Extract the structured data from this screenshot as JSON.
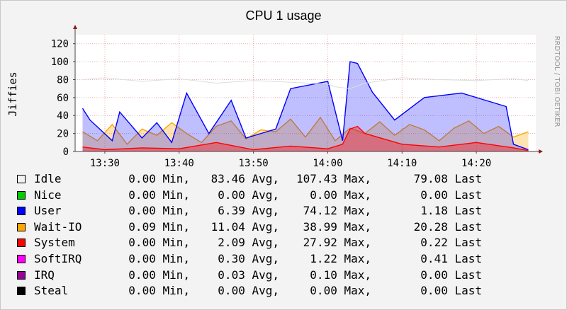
{
  "chart_data": {
    "type": "area",
    "title": "CPU 1 usage",
    "ylabel": "Jiffies",
    "watermark": "RRDTOOL / TOBI OETIKER",
    "ylim": [
      0,
      130
    ],
    "yticks": [
      0,
      20,
      40,
      60,
      80,
      100,
      120
    ],
    "xlim": [
      "13:26",
      "14:28"
    ],
    "xticks": [
      "13:30",
      "13:40",
      "13:50",
      "14:00",
      "14:10",
      "14:20"
    ],
    "grid": true,
    "series": [
      {
        "name": "Idle",
        "color": "#f2f2f2",
        "stats": {
          "min": "0.00",
          "avg": "83.46",
          "max": "107.43",
          "last": "79.08"
        },
        "x": [
          "13:27",
          "13:30",
          "13:35",
          "13:40",
          "13:45",
          "13:50",
          "13:55",
          "14:00",
          "14:01",
          "14:03",
          "14:05",
          "14:10",
          "14:15",
          "14:20",
          "14:25",
          "14:27"
        ],
        "values": [
          80,
          82,
          78,
          81,
          76,
          79,
          77,
          75,
          72,
          70,
          76,
          82,
          80,
          79,
          81,
          79
        ]
      },
      {
        "name": "Nice",
        "color": "#00cc00",
        "stats": {
          "min": "0.00",
          "avg": "0.00",
          "max": "0.00",
          "last": "0.00"
        },
        "values": []
      },
      {
        "name": "User",
        "color": "#0000ff",
        "stats": {
          "min": "0.00",
          "avg": "6.39",
          "max": "74.12",
          "last": "1.18"
        },
        "x": [
          "13:27",
          "13:28",
          "13:31",
          "13:32",
          "13:35",
          "13:37",
          "13:39",
          "13:41",
          "13:44",
          "13:47",
          "13:49",
          "13:53",
          "13:55",
          "14:00",
          "14:02",
          "14:03",
          "14:04",
          "14:06",
          "14:09",
          "14:13",
          "14:18",
          "14:24",
          "14:25",
          "14:27"
        ],
        "values": [
          48,
          35,
          12,
          44,
          15,
          32,
          10,
          65,
          20,
          57,
          15,
          25,
          70,
          78,
          12,
          100,
          98,
          66,
          35,
          60,
          65,
          50,
          8,
          2
        ]
      },
      {
        "name": "Wait-IO",
        "color": "#ffa500",
        "stats": {
          "min": "0.09",
          "avg": "11.04",
          "max": "38.99",
          "last": "20.28"
        },
        "x": [
          "13:27",
          "13:29",
          "13:31",
          "13:33",
          "13:35",
          "13:37",
          "13:39",
          "13:41",
          "13:43",
          "13:45",
          "13:47",
          "13:49",
          "13:51",
          "13:53",
          "13:55",
          "13:57",
          "13:59",
          "14:01",
          "14:03",
          "14:05",
          "14:07",
          "14:09",
          "14:11",
          "14:13",
          "14:15",
          "14:17",
          "14:19",
          "14:21",
          "14:23",
          "14:25",
          "14:27"
        ],
        "values": [
          22,
          12,
          30,
          8,
          25,
          18,
          32,
          20,
          10,
          28,
          34,
          14,
          24,
          22,
          36,
          16,
          38,
          12,
          26,
          20,
          33,
          18,
          30,
          24,
          12,
          26,
          34,
          20,
          28,
          16,
          22
        ]
      },
      {
        "name": "System",
        "color": "#ff0000",
        "stats": {
          "min": "0.00",
          "avg": "2.09",
          "max": "27.92",
          "last": "0.22"
        },
        "x": [
          "13:27",
          "13:30",
          "13:35",
          "13:40",
          "13:45",
          "13:50",
          "13:55",
          "14:00",
          "14:02",
          "14:03",
          "14:04",
          "14:05",
          "14:10",
          "14:15",
          "14:20",
          "14:25",
          "14:27"
        ],
        "values": [
          5,
          2,
          4,
          3,
          10,
          2,
          6,
          3,
          8,
          25,
          28,
          20,
          8,
          5,
          10,
          4,
          1
        ]
      },
      {
        "name": "SoftIRQ",
        "color": "#ff00ff",
        "stats": {
          "min": "0.00",
          "avg": "0.30",
          "max": "1.22",
          "last": "0.41"
        },
        "values": []
      },
      {
        "name": "IRQ",
        "color": "#990099",
        "stats": {
          "min": "0.00",
          "avg": "0.03",
          "max": "0.10",
          "last": "0.00"
        },
        "values": []
      },
      {
        "name": "Steal",
        "color": "#000000",
        "stats": {
          "min": "0.00",
          "avg": "0.00",
          "max": "0.00",
          "last": "0.00"
        },
        "values": []
      }
    ],
    "legend_units": {
      "min": "Min,",
      "avg": "Avg,",
      "max": "Max,",
      "last": "Last"
    }
  }
}
